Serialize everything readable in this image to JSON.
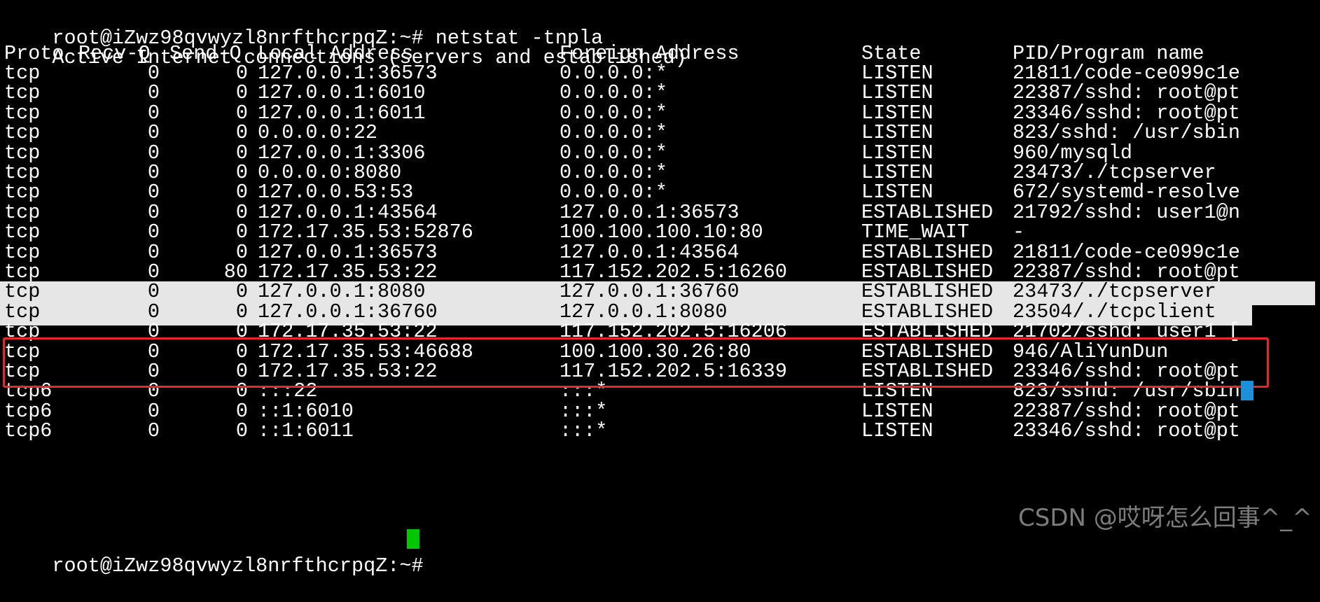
{
  "terminal": {
    "prompt_line": "root@iZwz98qvwyzl8nrfthcrpqZ:~# netstat -tnpla",
    "header_line": "Active Internet connections (servers and established)",
    "columns": [
      "Proto",
      "Recv-Q",
      "Send-Q",
      "Local Address",
      "Foreign Address",
      "State",
      "PID/Program name"
    ],
    "rows": [
      {
        "proto": "tcp",
        "recv": "0",
        "send": "0",
        "local": "127.0.0.1:36573",
        "foreign": "0.0.0.0:*",
        "state": "LISTEN",
        "pid": "21811/code-ce099c1e"
      },
      {
        "proto": "tcp",
        "recv": "0",
        "send": "0",
        "local": "127.0.0.1:6010",
        "foreign": "0.0.0.0:*",
        "state": "LISTEN",
        "pid": "22387/sshd: root@pt"
      },
      {
        "proto": "tcp",
        "recv": "0",
        "send": "0",
        "local": "127.0.0.1:6011",
        "foreign": "0.0.0.0:*",
        "state": "LISTEN",
        "pid": "23346/sshd: root@pt"
      },
      {
        "proto": "tcp",
        "recv": "0",
        "send": "0",
        "local": "0.0.0.0:22",
        "foreign": "0.0.0.0:*",
        "state": "LISTEN",
        "pid": "823/sshd: /usr/sbin"
      },
      {
        "proto": "tcp",
        "recv": "0",
        "send": "0",
        "local": "127.0.0.1:3306",
        "foreign": "0.0.0.0:*",
        "state": "LISTEN",
        "pid": "960/mysqld"
      },
      {
        "proto": "tcp",
        "recv": "0",
        "send": "0",
        "local": "0.0.0.0:8080",
        "foreign": "0.0.0.0:*",
        "state": "LISTEN",
        "pid": "23473/./tcpserver"
      },
      {
        "proto": "tcp",
        "recv": "0",
        "send": "0",
        "local": "127.0.0.53:53",
        "foreign": "0.0.0.0:*",
        "state": "LISTEN",
        "pid": "672/systemd-resolve"
      },
      {
        "proto": "tcp",
        "recv": "0",
        "send": "0",
        "local": "127.0.0.1:43564",
        "foreign": "127.0.0.1:36573",
        "state": "ESTABLISHED",
        "pid": "21792/sshd: user1@n"
      },
      {
        "proto": "tcp",
        "recv": "0",
        "send": "0",
        "local": "172.17.35.53:52876",
        "foreign": "100.100.100.10:80",
        "state": "TIME_WAIT",
        "pid": "-"
      },
      {
        "proto": "tcp",
        "recv": "0",
        "send": "0",
        "local": "127.0.0.1:36573",
        "foreign": "127.0.0.1:43564",
        "state": "ESTABLISHED",
        "pid": "21811/code-ce099c1e"
      },
      {
        "proto": "tcp",
        "recv": "0",
        "send": "80",
        "local": "172.17.35.53:22",
        "foreign": "117.152.202.5:16260",
        "state": "ESTABLISHED",
        "pid": "22387/sshd: root@pt"
      },
      {
        "proto": "tcp",
        "recv": "0",
        "send": "0",
        "local": "127.0.0.1:8080",
        "foreign": "127.0.0.1:36760",
        "state": "ESTABLISHED",
        "pid": "23473/./tcpserver"
      },
      {
        "proto": "tcp",
        "recv": "0",
        "send": "0",
        "local": "127.0.0.1:36760",
        "foreign": "127.0.0.1:8080",
        "state": "ESTABLISHED",
        "pid": "23504/./tcpclient"
      },
      {
        "proto": "tcp",
        "recv": "0",
        "send": "0",
        "local": "172.17.35.53:22",
        "foreign": "117.152.202.5:16206",
        "state": "ESTABLISHED",
        "pid": "21702/sshd: user1 ["
      },
      {
        "proto": "tcp",
        "recv": "0",
        "send": "0",
        "local": "172.17.35.53:46688",
        "foreign": "100.100.30.26:80",
        "state": "ESTABLISHED",
        "pid": "946/AliYunDun"
      },
      {
        "proto": "tcp",
        "recv": "0",
        "send": "0",
        "local": "172.17.35.53:22",
        "foreign": "117.152.202.5:16339",
        "state": "ESTABLISHED",
        "pid": "23346/sshd: root@pt"
      },
      {
        "proto": "tcp6",
        "recv": "0",
        "send": "0",
        "local": ":::22",
        "foreign": ":::*",
        "state": "LISTEN",
        "pid": "823/sshd: /usr/sbin"
      },
      {
        "proto": "tcp6",
        "recv": "0",
        "send": "0",
        "local": "::1:6010",
        "foreign": ":::*",
        "state": "LISTEN",
        "pid": "22387/sshd: root@pt"
      },
      {
        "proto": "tcp6",
        "recv": "0",
        "send": "0",
        "local": "::1:6011",
        "foreign": ":::*",
        "state": "LISTEN",
        "pid": "23346/sshd: root@pt"
      }
    ],
    "next_prompt": "root@iZwz98qvwyzl8nrfthcrpqZ:~# ",
    "highlighted_rows": [
      11,
      12
    ],
    "highlight_color": "#e8262d",
    "selection_color": "#e6e6e6",
    "cursor_color": "#00c800"
  },
  "watermark": {
    "text": "CSDN @哎呀怎么回事^_^"
  }
}
